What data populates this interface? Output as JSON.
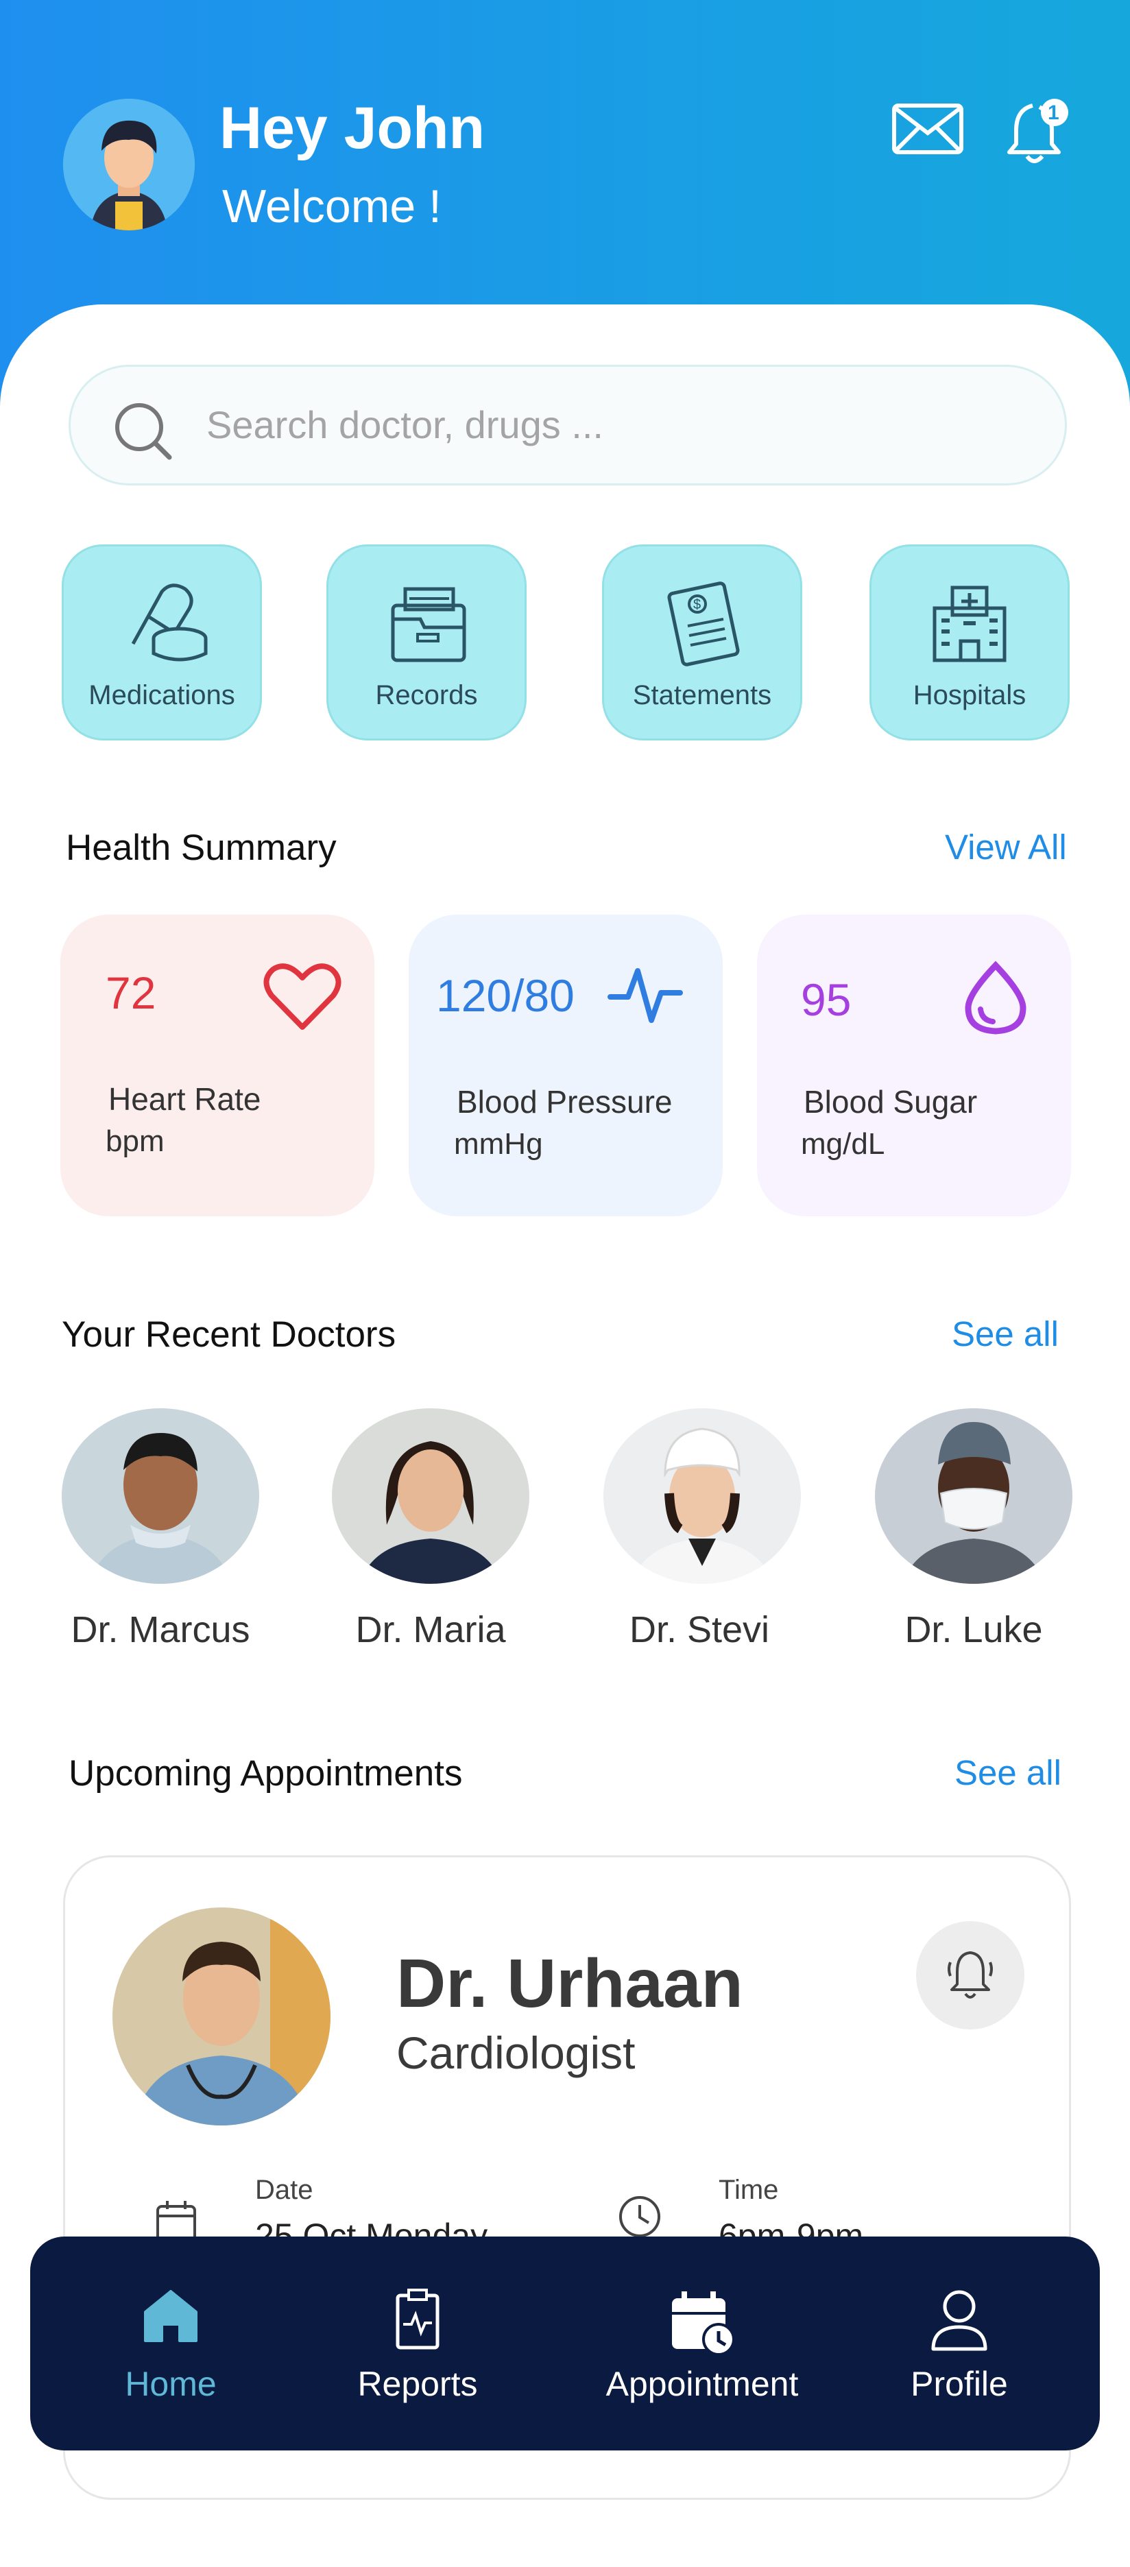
{
  "header": {
    "greeting": "Hey John",
    "subtitle": "Welcome !",
    "notification_count": "1",
    "mail_icon": "mail-icon",
    "bell_icon": "bell-icon"
  },
  "search": {
    "placeholder": "Search doctor, drugs ..."
  },
  "quick_actions": [
    {
      "label": "Medications",
      "icon": "pill-icon"
    },
    {
      "label": "Records",
      "icon": "folder-icon"
    },
    {
      "label": "Statements",
      "icon": "statement-icon"
    },
    {
      "label": "Hospitals",
      "icon": "hospital-icon"
    }
  ],
  "health_summary": {
    "title": "Health Summary",
    "link": "View All",
    "cards": [
      {
        "value": "72",
        "name": "Heart Rate",
        "unit": "bpm",
        "icon": "heart-icon",
        "color": "#e0343f"
      },
      {
        "value": "120/80",
        "name": "Blood Pressure",
        "unit": "mmHg",
        "icon": "pulse-icon",
        "color": "#2f7de0"
      },
      {
        "value": "95",
        "name": "Blood Sugar",
        "unit": "mg/dL",
        "icon": "drop-icon",
        "color": "#a53fe0"
      }
    ]
  },
  "recent_doctors": {
    "title": "Your Recent Doctors",
    "link": "See all",
    "doctors": [
      {
        "name": "Dr. Marcus"
      },
      {
        "name": "Dr. Maria"
      },
      {
        "name": "Dr. Stevi"
      },
      {
        "name": "Dr. Luke"
      }
    ]
  },
  "appointments": {
    "title": "Upcoming Appointments",
    "link": "See all",
    "doctor": "Dr. Urhaan",
    "specialty": "Cardiologist",
    "date_label": "Date",
    "date_value": "25 Oct Monday",
    "time_label": "Time",
    "time_value": "6pm-9pm"
  },
  "nav": {
    "items": [
      {
        "label": "Home",
        "icon": "home-icon",
        "active": true
      },
      {
        "label": "Reports",
        "icon": "report-icon",
        "active": false
      },
      {
        "label": "Appointment",
        "icon": "calendar-icon",
        "active": false
      },
      {
        "label": "Profile",
        "icon": "profile-icon",
        "active": false
      }
    ]
  },
  "colors": {
    "header_gradient_start": "#1f8fef",
    "header_gradient_end": "#16a8dc",
    "accent": "#1f8de6",
    "tile_bg": "#a9ecf2",
    "nav_bg": "#0a1a40",
    "nav_active": "#5fb8d6"
  }
}
